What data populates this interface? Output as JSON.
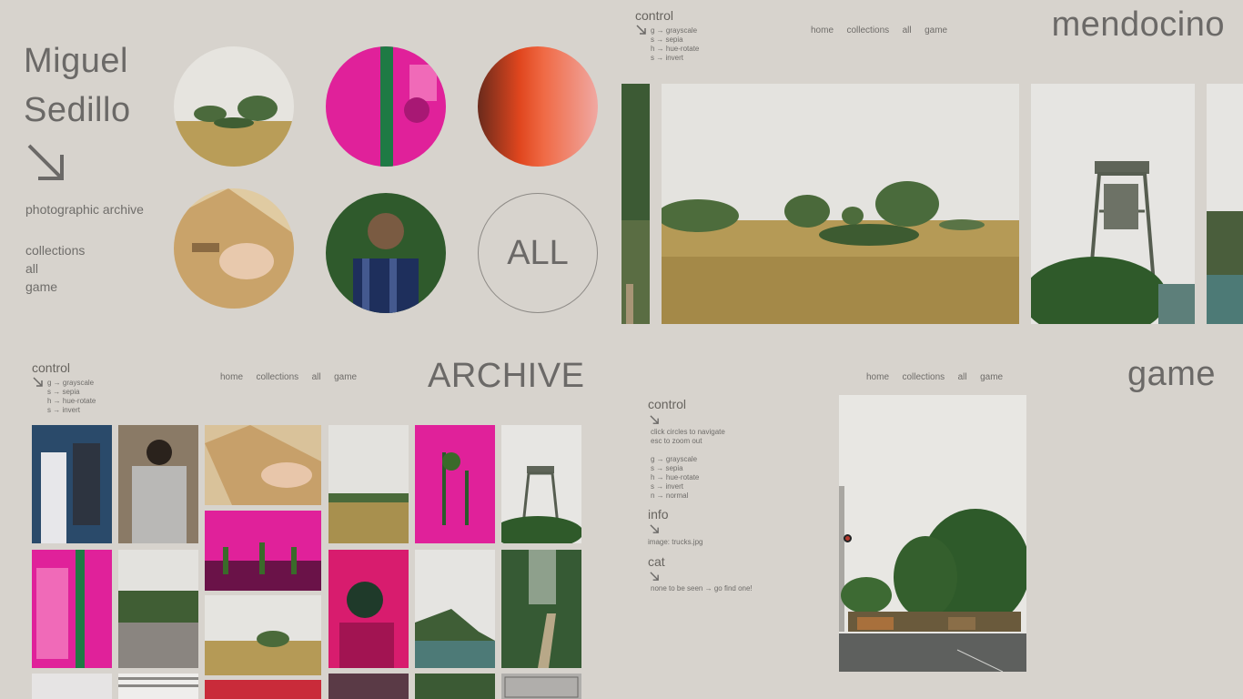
{
  "home": {
    "name_line1": "Miguel",
    "name_line2": "Sedillo",
    "subtitle": "photographic archive",
    "links": [
      "collections",
      "all",
      "game"
    ],
    "all_label": "ALL"
  },
  "mendocino": {
    "control_title": "control",
    "controls": [
      "g → grayscale",
      "s → sepia",
      "h → hue-rotate",
      "s → invert"
    ],
    "nav": [
      "home",
      "collections",
      "all",
      "game"
    ],
    "title": "mendocino"
  },
  "archive": {
    "control_title": "control",
    "controls": [
      "g → grayscale",
      "s → sepia",
      "h → hue-rotate",
      "s → invert"
    ],
    "nav": [
      "home",
      "collections",
      "all",
      "game"
    ],
    "title": "ARCHIVE"
  },
  "game": {
    "nav": [
      "home",
      "collections",
      "all",
      "game"
    ],
    "title": "game",
    "control_title": "control",
    "control_hints": [
      "click circles to navigate",
      "esc to zoom out"
    ],
    "controls": [
      "g → grayscale",
      "s → sepia",
      "h → hue-rotate",
      "s → invert",
      "n → normal"
    ],
    "info_title": "info",
    "info_text": "image: trucks.jpg",
    "cat_title": "cat",
    "cat_text": "none to be seen → go find one!"
  },
  "colors": {
    "background": "#d7d3cd",
    "text": "#6b6967",
    "magenta": "#e0219a",
    "grass": "#b79a55",
    "sky": "#e8e6e2"
  }
}
